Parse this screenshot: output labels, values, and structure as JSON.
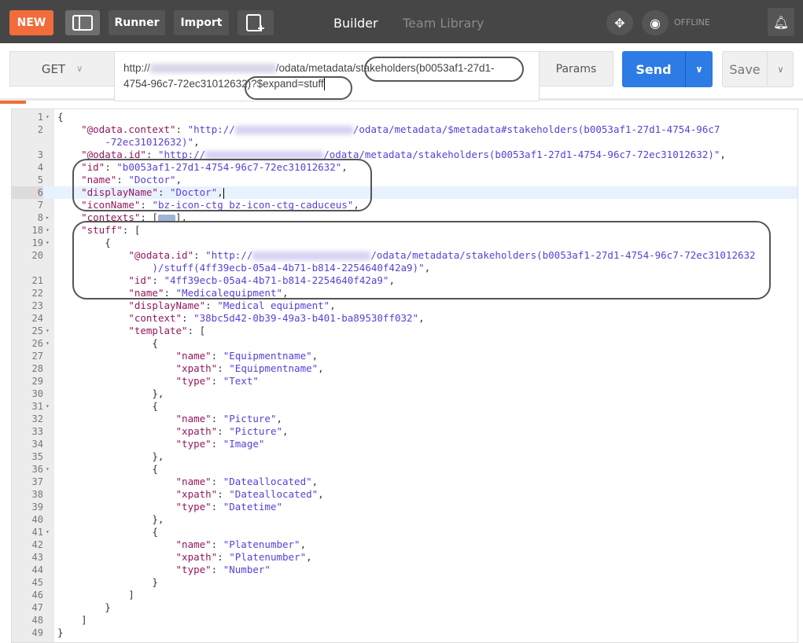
{
  "topbar": {
    "new_label": "NEW",
    "runner_label": "Runner",
    "import_label": "Import",
    "builder_tab": "Builder",
    "team_library_tab": "Team Library",
    "status": "OFFLINE"
  },
  "request": {
    "method": "GET",
    "url_prefix": "http://",
    "url_line1_rest": "/odata/metadata/stakeholders(b0053af1-27d1-",
    "url_line2": "4754-96c7-72ec31012632)?$expand=stuff",
    "params_label": "Params",
    "send_label": "Send",
    "save_label": "Save"
  },
  "colors": {
    "accent": "#f26b3a",
    "send": "#2d7be5",
    "key": "#92185e",
    "string": "#5a3fd8"
  },
  "editor": {
    "highlighted_line": "6",
    "lines": [
      {
        "n": "1",
        "f": "▾",
        "t": [
          [
            "p",
            "{"
          ]
        ]
      },
      {
        "n": "2",
        "t": [
          [
            "p",
            "    "
          ],
          [
            "k",
            "\"@odata.context\""
          ],
          [
            "p",
            ": "
          ],
          [
            "s",
            "\"http://"
          ],
          [
            "b",
            ""
          ],
          [
            "s",
            "/odata/metadata/$metadata#stakeholders(b0053af1-27d1-4754-96c7"
          ]
        ]
      },
      {
        "n": "",
        "t": [
          [
            "s",
            "        -72ec31012632)\""
          ],
          [
            "p",
            ","
          ]
        ]
      },
      {
        "n": "3",
        "t": [
          [
            "p",
            "    "
          ],
          [
            "k",
            "\"@odata.id\""
          ],
          [
            "p",
            ": "
          ],
          [
            "s",
            "\"http://"
          ],
          [
            "b",
            ""
          ],
          [
            "s",
            "/odata/metadata/stakeholders(b0053af1-27d1-4754-96c7-72ec31012632)\""
          ],
          [
            "p",
            ","
          ]
        ]
      },
      {
        "n": "4",
        "t": [
          [
            "p",
            "    "
          ],
          [
            "k",
            "\"id\""
          ],
          [
            "p",
            ": "
          ],
          [
            "s",
            "\"b0053af1-27d1-4754-96c7-72ec31012632\""
          ],
          [
            "p",
            ","
          ]
        ]
      },
      {
        "n": "5",
        "t": [
          [
            "p",
            "    "
          ],
          [
            "k",
            "\"name\""
          ],
          [
            "p",
            ": "
          ],
          [
            "s",
            "\"Doctor\""
          ],
          [
            "p",
            ","
          ]
        ]
      },
      {
        "n": "6",
        "t": [
          [
            "p",
            "    "
          ],
          [
            "k",
            "\"displayName\""
          ],
          [
            "p",
            ": "
          ],
          [
            "s",
            "\"Doctor\""
          ],
          [
            "p",
            ","
          ],
          [
            "c",
            ""
          ]
        ]
      },
      {
        "n": "7",
        "t": [
          [
            "p",
            "    "
          ],
          [
            "k",
            "\"iconName\""
          ],
          [
            "p",
            ": "
          ],
          [
            "s",
            "\"bz-icon-ctg bz-icon-ctg-caduceus\""
          ],
          [
            "p",
            ","
          ]
        ]
      },
      {
        "n": "8",
        "f": "▸",
        "t": [
          [
            "p",
            "    "
          ],
          [
            "k",
            "\"contexts\""
          ],
          [
            "p",
            ": ["
          ],
          [
            "x",
            ""
          ],
          [
            "p",
            "],"
          ]
        ]
      },
      {
        "n": "18",
        "f": "▾",
        "t": [
          [
            "p",
            "    "
          ],
          [
            "k",
            "\"stuff\""
          ],
          [
            "p",
            ": ["
          ]
        ]
      },
      {
        "n": "19",
        "f": "▾",
        "t": [
          [
            "p",
            "        {"
          ]
        ]
      },
      {
        "n": "20",
        "t": [
          [
            "p",
            "            "
          ],
          [
            "k",
            "\"@odata.id\""
          ],
          [
            "p",
            ": "
          ],
          [
            "s",
            "\"http://"
          ],
          [
            "b",
            ""
          ],
          [
            "s",
            "/odata/metadata/stakeholders(b0053af1-27d1-4754-96c7-72ec31012632"
          ]
        ]
      },
      {
        "n": "",
        "t": [
          [
            "s",
            "                )/stuff(4ff39ecb-05a4-4b71-b814-2254640f42a9)\""
          ],
          [
            "p",
            ","
          ]
        ]
      },
      {
        "n": "21",
        "t": [
          [
            "p",
            "            "
          ],
          [
            "k",
            "\"id\""
          ],
          [
            "p",
            ": "
          ],
          [
            "s",
            "\"4ff39ecb-05a4-4b71-b814-2254640f42a9\""
          ],
          [
            "p",
            ","
          ]
        ]
      },
      {
        "n": "22",
        "t": [
          [
            "p",
            "            "
          ],
          [
            "k",
            "\"name\""
          ],
          [
            "p",
            ": "
          ],
          [
            "s",
            "\"Medicalequipment\""
          ],
          [
            "p",
            ","
          ]
        ]
      },
      {
        "n": "23",
        "t": [
          [
            "p",
            "            "
          ],
          [
            "k",
            "\"displayName\""
          ],
          [
            "p",
            ": "
          ],
          [
            "s",
            "\"Medical equipment\""
          ],
          [
            "p",
            ","
          ]
        ]
      },
      {
        "n": "24",
        "t": [
          [
            "p",
            "            "
          ],
          [
            "k",
            "\"context\""
          ],
          [
            "p",
            ": "
          ],
          [
            "s",
            "\"38bc5d42-0b39-49a3-b401-ba89530ff032\""
          ],
          [
            "p",
            ","
          ]
        ]
      },
      {
        "n": "25",
        "f": "▾",
        "t": [
          [
            "p",
            "            "
          ],
          [
            "k",
            "\"template\""
          ],
          [
            "p",
            ": ["
          ]
        ]
      },
      {
        "n": "26",
        "f": "▾",
        "t": [
          [
            "p",
            "                {"
          ]
        ]
      },
      {
        "n": "27",
        "t": [
          [
            "p",
            "                    "
          ],
          [
            "k",
            "\"name\""
          ],
          [
            "p",
            ": "
          ],
          [
            "s",
            "\"Equipmentname\""
          ],
          [
            "p",
            ","
          ]
        ]
      },
      {
        "n": "28",
        "t": [
          [
            "p",
            "                    "
          ],
          [
            "k",
            "\"xpath\""
          ],
          [
            "p",
            ": "
          ],
          [
            "s",
            "\"Equipmentname\""
          ],
          [
            "p",
            ","
          ]
        ]
      },
      {
        "n": "29",
        "t": [
          [
            "p",
            "                    "
          ],
          [
            "k",
            "\"type\""
          ],
          [
            "p",
            ": "
          ],
          [
            "s",
            "\"Text\""
          ]
        ]
      },
      {
        "n": "30",
        "t": [
          [
            "p",
            "                },"
          ]
        ]
      },
      {
        "n": "31",
        "f": "▾",
        "t": [
          [
            "p",
            "                {"
          ]
        ]
      },
      {
        "n": "32",
        "t": [
          [
            "p",
            "                    "
          ],
          [
            "k",
            "\"name\""
          ],
          [
            "p",
            ": "
          ],
          [
            "s",
            "\"Picture\""
          ],
          [
            "p",
            ","
          ]
        ]
      },
      {
        "n": "33",
        "t": [
          [
            "p",
            "                    "
          ],
          [
            "k",
            "\"xpath\""
          ],
          [
            "p",
            ": "
          ],
          [
            "s",
            "\"Picture\""
          ],
          [
            "p",
            ","
          ]
        ]
      },
      {
        "n": "34",
        "t": [
          [
            "p",
            "                    "
          ],
          [
            "k",
            "\"type\""
          ],
          [
            "p",
            ": "
          ],
          [
            "s",
            "\"Image\""
          ]
        ]
      },
      {
        "n": "35",
        "t": [
          [
            "p",
            "                },"
          ]
        ]
      },
      {
        "n": "36",
        "f": "▾",
        "t": [
          [
            "p",
            "                {"
          ]
        ]
      },
      {
        "n": "37",
        "t": [
          [
            "p",
            "                    "
          ],
          [
            "k",
            "\"name\""
          ],
          [
            "p",
            ": "
          ],
          [
            "s",
            "\"Dateallocated\""
          ],
          [
            "p",
            ","
          ]
        ]
      },
      {
        "n": "38",
        "t": [
          [
            "p",
            "                    "
          ],
          [
            "k",
            "\"xpath\""
          ],
          [
            "p",
            ": "
          ],
          [
            "s",
            "\"Dateallocated\""
          ],
          [
            "p",
            ","
          ]
        ]
      },
      {
        "n": "39",
        "t": [
          [
            "p",
            "                    "
          ],
          [
            "k",
            "\"type\""
          ],
          [
            "p",
            ": "
          ],
          [
            "s",
            "\"Datetime\""
          ]
        ]
      },
      {
        "n": "40",
        "t": [
          [
            "p",
            "                },"
          ]
        ]
      },
      {
        "n": "41",
        "f": "▾",
        "t": [
          [
            "p",
            "                {"
          ]
        ]
      },
      {
        "n": "42",
        "t": [
          [
            "p",
            "                    "
          ],
          [
            "k",
            "\"name\""
          ],
          [
            "p",
            ": "
          ],
          [
            "s",
            "\"Platenumber\""
          ],
          [
            "p",
            ","
          ]
        ]
      },
      {
        "n": "43",
        "t": [
          [
            "p",
            "                    "
          ],
          [
            "k",
            "\"xpath\""
          ],
          [
            "p",
            ": "
          ],
          [
            "s",
            "\"Platenumber\""
          ],
          [
            "p",
            ","
          ]
        ]
      },
      {
        "n": "44",
        "t": [
          [
            "p",
            "                    "
          ],
          [
            "k",
            "\"type\""
          ],
          [
            "p",
            ": "
          ],
          [
            "s",
            "\"Number\""
          ]
        ]
      },
      {
        "n": "45",
        "t": [
          [
            "p",
            "                }"
          ]
        ]
      },
      {
        "n": "46",
        "t": [
          [
            "p",
            "            ]"
          ]
        ]
      },
      {
        "n": "47",
        "t": [
          [
            "p",
            "        }"
          ]
        ]
      },
      {
        "n": "48",
        "t": [
          [
            "p",
            "    ]"
          ]
        ]
      },
      {
        "n": "49",
        "t": [
          [
            "p",
            "}"
          ]
        ]
      }
    ]
  }
}
